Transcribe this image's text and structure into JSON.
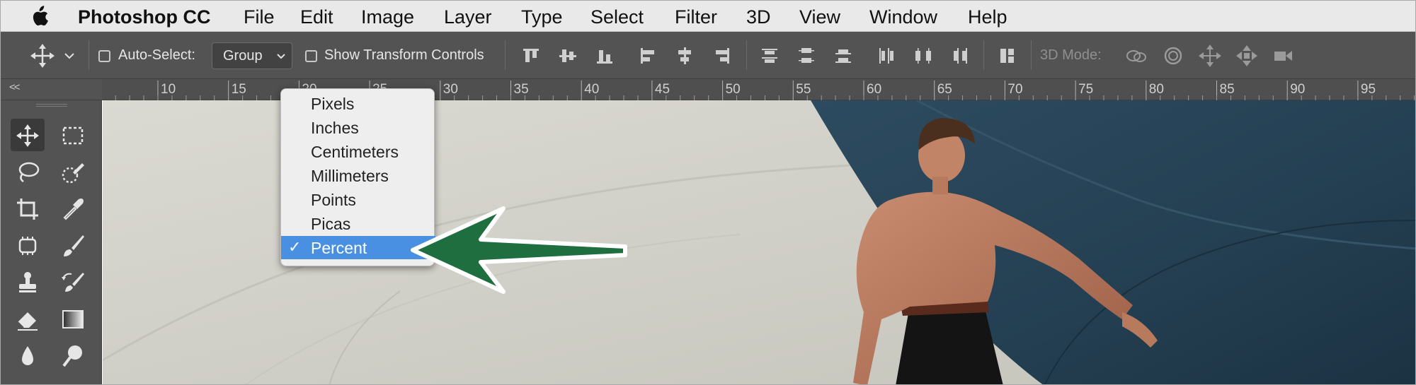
{
  "menubar": {
    "items": [
      "Photoshop CC",
      "File",
      "Edit",
      "Image",
      "Layer",
      "Type",
      "Select",
      "Filter",
      "3D",
      "View",
      "Window",
      "Help"
    ]
  },
  "options_bar": {
    "auto_select_label": "Auto-Select:",
    "auto_select_checked": false,
    "auto_select_value": "Group",
    "show_transform_label": "Show Transform Controls",
    "show_transform_checked": false,
    "mode_label": "3D Mode:"
  },
  "ruler": {
    "expand_label": "<<",
    "ticks": [
      "10",
      "15",
      "20",
      "25",
      "30",
      "35",
      "40",
      "45",
      "50",
      "55",
      "60",
      "65",
      "70",
      "75",
      "80",
      "85",
      "90",
      "95"
    ]
  },
  "units_menu": {
    "items": [
      {
        "label": "Pixels",
        "checked": false
      },
      {
        "label": "Inches",
        "checked": false
      },
      {
        "label": "Centimeters",
        "checked": false
      },
      {
        "label": "Millimeters",
        "checked": false
      },
      {
        "label": "Points",
        "checked": false
      },
      {
        "label": "Picas",
        "checked": false
      },
      {
        "label": "Percent",
        "checked": true
      }
    ],
    "check_glyph": "✓"
  },
  "tools": [
    {
      "name": "move-tool-icon",
      "active": true
    },
    {
      "name": "marquee-tool-icon",
      "active": false
    },
    {
      "name": "lasso-tool-icon",
      "active": false
    },
    {
      "name": "quick-select-tool-icon",
      "active": false
    },
    {
      "name": "crop-tool-icon",
      "active": false
    },
    {
      "name": "eyedropper-tool-icon",
      "active": false
    },
    {
      "name": "spot-healing-tool-icon",
      "active": false
    },
    {
      "name": "brush-tool-icon",
      "active": false
    },
    {
      "name": "clone-stamp-tool-icon",
      "active": false
    },
    {
      "name": "history-brush-tool-icon",
      "active": false
    },
    {
      "name": "eraser-tool-icon",
      "active": false
    },
    {
      "name": "gradient-tool-icon",
      "active": false
    },
    {
      "name": "blur-tool-icon",
      "active": false
    },
    {
      "name": "dodge-tool-icon",
      "active": false
    }
  ],
  "colors": {
    "menubar_bg": "#e9e9e9",
    "panel_bg": "#535353",
    "selection_blue": "#4a90e2",
    "arrow_green": "#1f6e3f"
  }
}
